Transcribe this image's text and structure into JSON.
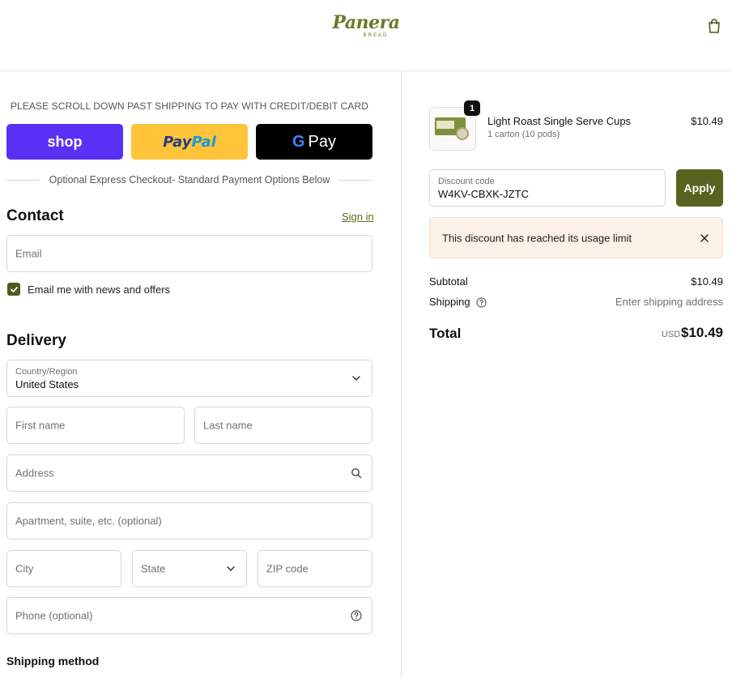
{
  "header": {
    "logo_text": "Panera",
    "logo_subtext": "BREAD"
  },
  "express": {
    "notice": "PLEASE SCROLL DOWN PAST SHIPPING TO PAY WITH CREDIT/DEBIT CARD",
    "shop_label": "shop",
    "paypal_label_dark": "Pay",
    "paypal_label_light": "Pal",
    "gpay_g": "G",
    "gpay_label": "Pay",
    "divider_text": "Optional Express Checkout- Standard Payment Options Below"
  },
  "contact": {
    "title": "Contact",
    "sign_in": "Sign in",
    "email_placeholder": "Email",
    "newsletter_label": "Email me with news and offers",
    "newsletter_checked": true
  },
  "delivery": {
    "title": "Delivery",
    "country_label": "Country/Region",
    "country_value": "United States",
    "first_name": "First name",
    "last_name": "Last name",
    "address": "Address",
    "apartment": "Apartment, suite, etc. (optional)",
    "city": "City",
    "state": "State",
    "zip": "ZIP code",
    "phone": "Phone (optional)"
  },
  "shipping_method": {
    "title": "Shipping method"
  },
  "order": {
    "item": {
      "quantity": "1",
      "name": "Light Roast Single Serve Cups",
      "variant": "1 carton (10 pods)",
      "price": "$10.49"
    },
    "discount": {
      "label": "Discount code",
      "value": "W4KV-CBXK-JZTC",
      "apply_label": "Apply",
      "alert": "This discount has reached its usage limit"
    },
    "summary": {
      "subtotal_label": "Subtotal",
      "subtotal_value": "$10.49",
      "shipping_label": "Shipping",
      "shipping_value": "Enter shipping address",
      "total_label": "Total",
      "currency": "USD",
      "total_value": "$10.49"
    }
  },
  "colors": {
    "accent": "#58631f",
    "shop": "#5a31f4",
    "paypal": "#ffc439",
    "alert_bg": "#fbf1e6"
  }
}
